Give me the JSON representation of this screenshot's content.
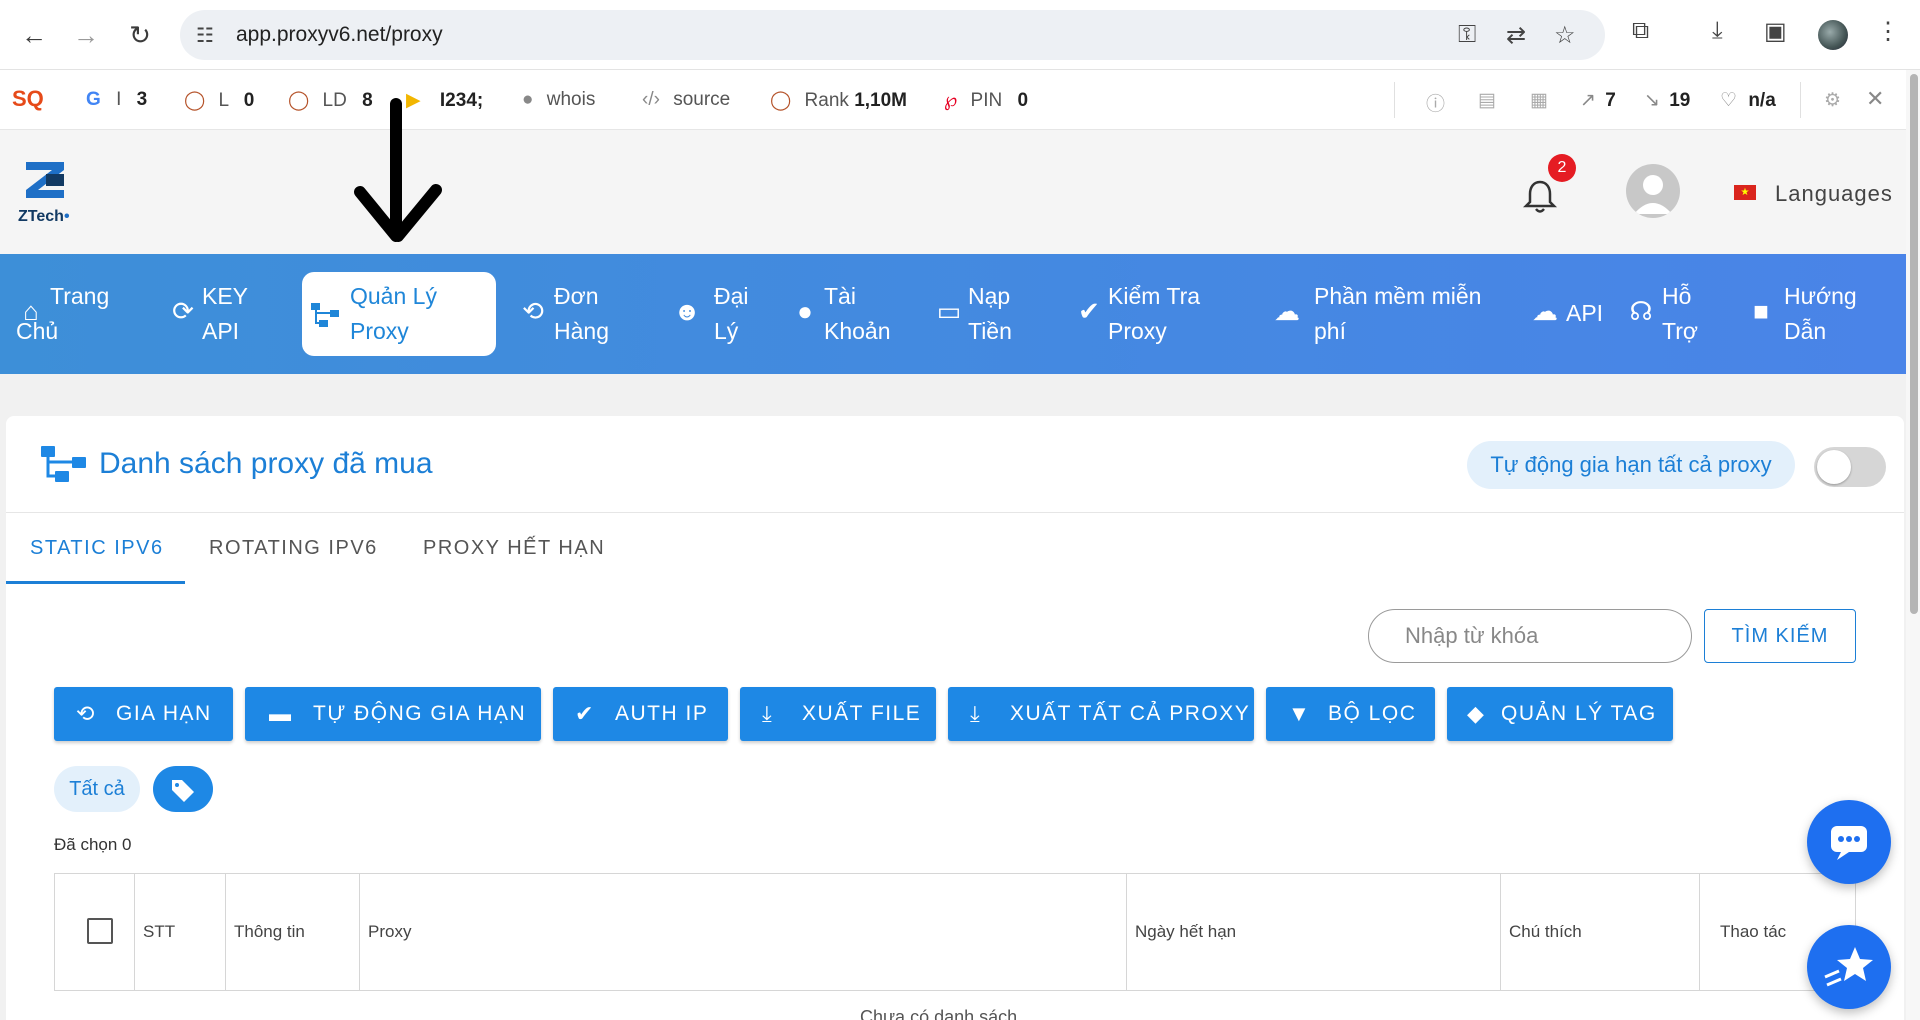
{
  "browser": {
    "url": "app.proxyv6.net/proxy",
    "icons": [
      "back-icon",
      "forward-icon",
      "reload-icon",
      "tune-icon",
      "key-icon",
      "translate-icon",
      "star-icon",
      "extensions-icon",
      "download-icon",
      "sidepanel-icon",
      "menu-icon"
    ]
  },
  "seobar": {
    "logo": "SQ",
    "google_label": "I",
    "google_value": "3",
    "l_label": "L",
    "l_value": "0",
    "ld_label": "LD",
    "ld_value": "8",
    "bing_value": "I234;",
    "whois": "whois",
    "source": "source",
    "rank_label": "Rank",
    "rank_value": "1,10M",
    "pin_label": "PIN",
    "pin_value": "0",
    "ext_links": "7",
    "int_links": "19",
    "health": "n/a"
  },
  "header": {
    "logo_text": "ZTech",
    "notification_count": "2",
    "languages": "Languages",
    "flag_star": "★"
  },
  "nav": {
    "items": [
      {
        "line1": "Trang",
        "line2": "Chủ",
        "icon": "home-icon"
      },
      {
        "line1": "KEY",
        "line2": "API",
        "icon": "sync-icon"
      },
      {
        "line1": "Quản Lý",
        "line2": "Proxy",
        "icon": "sitemap-icon"
      },
      {
        "line1": "Đơn",
        "line2": "Hàng",
        "icon": "history-icon"
      },
      {
        "line1": "Đại",
        "line2": "Lý",
        "icon": "users-icon"
      },
      {
        "line1": "Tài",
        "line2": "Khoản",
        "icon": "user-icon"
      },
      {
        "line1": "Nạp",
        "line2": "Tiền",
        "icon": "wallet-icon"
      },
      {
        "line1": "Kiểm Tra",
        "line2": "Proxy",
        "icon": "check-circle-icon"
      },
      {
        "line1": "Phần mềm miễn",
        "line2": "phí",
        "icon": "cloud-download-icon"
      },
      {
        "line1": "API",
        "line2": "",
        "icon": "cloud-icon"
      },
      {
        "line1": "Hỗ",
        "line2": "Trợ",
        "icon": "headset-icon"
      },
      {
        "line1": "Hướng",
        "line2": "Dẫn",
        "icon": "video-icon"
      }
    ]
  },
  "card": {
    "title": "Danh sách proxy đã mua",
    "auto_renew_all": "Tự động gia hạn tất cả proxy",
    "auto_renew_enabled": false
  },
  "tabs": [
    "STATIC IPV6",
    "ROTATING IPV6",
    "PROXY HẾT HẠN"
  ],
  "search": {
    "placeholder": "Nhập từ khóa",
    "button": "TÌM KIẾM"
  },
  "actions": {
    "renew": "GIA HẠN",
    "auto_renew": "TỰ ĐỘNG GIA HẠN",
    "auth_ip": "AUTH IP",
    "export_file": "XUẤT FILE",
    "export_all": "XUẤT TẤT CẢ PROXY",
    "filter": "BỘ LỌC",
    "manage_tag": "QUẢN LÝ TAG"
  },
  "filters": {
    "all": "Tất cả"
  },
  "selected": "Đã chọn 0",
  "table": {
    "columns": [
      "STT",
      "Thông tin",
      "Proxy",
      "Ngày hết hạn",
      "Chú thích",
      "Thao tác"
    ],
    "empty_text": "Chưa có danh sách"
  }
}
